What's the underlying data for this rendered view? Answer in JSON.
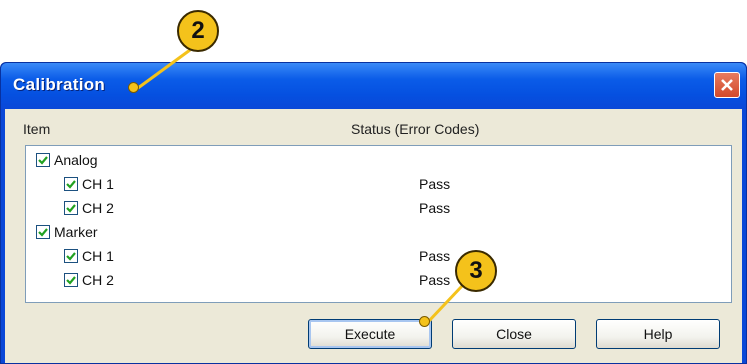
{
  "callouts": {
    "first": "2",
    "second": "3"
  },
  "window": {
    "title": "Calibration",
    "close_icon": "close-x-icon"
  },
  "list": {
    "col_item": "Item",
    "col_status": "Status (Error Codes)",
    "rows": [
      {
        "label": "Analog",
        "checked": true,
        "status": ""
      },
      {
        "label": "CH 1",
        "checked": true,
        "status": "Pass"
      },
      {
        "label": "CH 2",
        "checked": true,
        "status": "Pass"
      },
      {
        "label": "Marker",
        "checked": true,
        "status": ""
      },
      {
        "label": "CH 1",
        "checked": true,
        "status": "Pass"
      },
      {
        "label": "CH 2",
        "checked": true,
        "status": "Pass"
      }
    ]
  },
  "buttons": {
    "execute": "Execute",
    "close": "Close",
    "help": "Help"
  },
  "colors": {
    "callout": "#f4c21b",
    "titlebar": "#0a48d8",
    "checkmark": "#21a121"
  }
}
